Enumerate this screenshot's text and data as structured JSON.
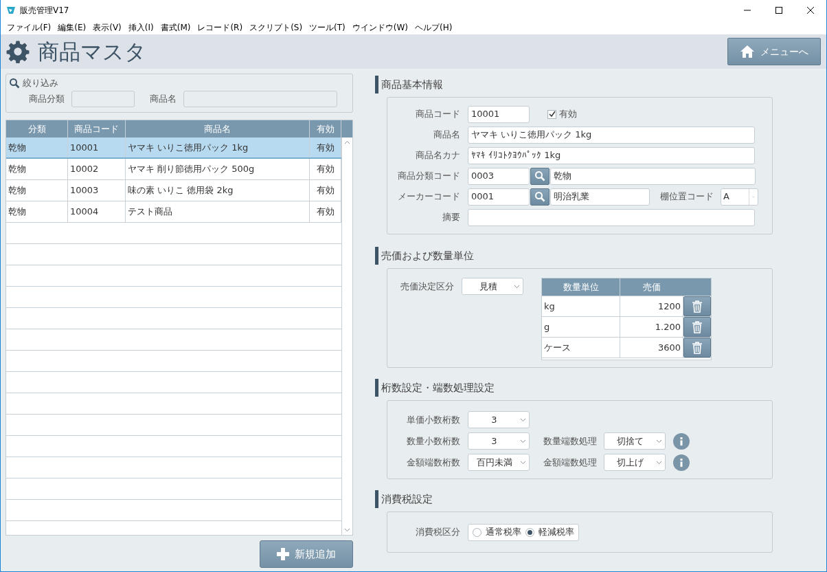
{
  "window": {
    "title": "販売管理V17"
  },
  "menu": [
    "ファイル(F)",
    "編集(E)",
    "表示(V)",
    "挿入(I)",
    "書式(M)",
    "レコード(R)",
    "スクリプト(S)",
    "ツール(T)",
    "ウインドウ(W)",
    "ヘルプ(H)"
  ],
  "header": {
    "title": "商品マスタ",
    "menu_button": "メニューへ"
  },
  "filter": {
    "title": "絞り込み",
    "fields": [
      {
        "label": "商品分類"
      },
      {
        "label": "商品名"
      }
    ]
  },
  "list": {
    "columns": [
      "分類",
      "商品コード",
      "商品名",
      "有効"
    ],
    "rows": [
      {
        "category": "乾物",
        "code": "10001",
        "name": "ヤマキ いりこ徳用パック 1kg",
        "valid": "有効",
        "selected": true
      },
      {
        "category": "乾物",
        "code": "10002",
        "name": "ヤマキ 削り節徳用パック 500g",
        "valid": "有効",
        "selected": false
      },
      {
        "category": "乾物",
        "code": "10003",
        "name": "味の素 いりこ 徳用袋 2kg",
        "valid": "有効",
        "selected": false
      },
      {
        "category": "乾物",
        "code": "10004",
        "name": "テスト商品",
        "valid": "有効",
        "selected": false
      }
    ]
  },
  "add_button": "新規追加",
  "basic": {
    "title": "商品基本情報",
    "code": {
      "label": "商品コード",
      "value": "10001"
    },
    "active": {
      "label": "有効",
      "checked": true
    },
    "name": {
      "label": "商品名",
      "value": "ヤマキ いりこ徳用パック 1kg"
    },
    "kana": {
      "label": "商品名カナ",
      "value": "ﾔﾏｷ ｲﾘｺﾄｸﾖｳﾊﾟｯｸ 1kg"
    },
    "category": {
      "label": "商品分類コード",
      "value": "0003",
      "name": "乾物"
    },
    "maker": {
      "label": "メーカーコード",
      "value": "0001",
      "name": "明治乳業"
    },
    "shelf": {
      "label": "棚位置コード",
      "value": "A"
    },
    "summary": {
      "label": "摘要"
    }
  },
  "pricing": {
    "title": "売価および数量単位",
    "mode": {
      "label": "売価決定区分",
      "value": "見積"
    },
    "columns": [
      "数量単位",
      "売価"
    ],
    "units": [
      {
        "unit": "kg",
        "price": "1200"
      },
      {
        "unit": "g",
        "price": "1.200"
      },
      {
        "unit": "ケース",
        "price": "3600"
      }
    ]
  },
  "digits": {
    "title": "桁数設定・端数処理設定",
    "rows": [
      {
        "left": {
          "label": "単価小数桁数",
          "value": "3"
        }
      },
      {
        "left": {
          "label": "数量小数桁数",
          "value": "3"
        },
        "right": {
          "label": "数量端数処理",
          "value": "切捨て"
        }
      },
      {
        "left": {
          "label": "金額端数桁数",
          "value": "百円未満"
        },
        "right": {
          "label": "金額端数処理",
          "value": "切上げ"
        }
      }
    ]
  },
  "tax": {
    "title": "消費税設定",
    "label": "消費税区分",
    "options": [
      {
        "label": "通常税率",
        "selected": false
      },
      {
        "label": "軽減税率",
        "selected": true
      }
    ]
  }
}
